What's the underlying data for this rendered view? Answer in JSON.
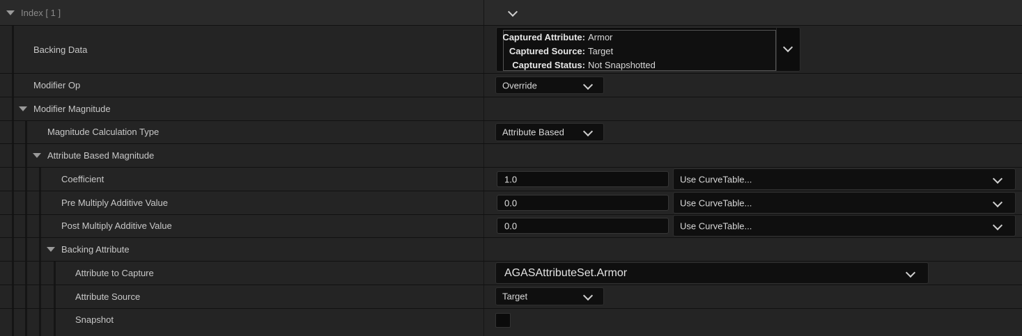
{
  "header": {
    "index_label": "Index [ 1 ]"
  },
  "backing_data": {
    "label": "Backing Data",
    "captured_attribute_key": "Captured Attribute:",
    "captured_attribute_value": "Armor",
    "captured_source_key": "Captured Source:",
    "captured_source_value": "Target",
    "captured_status_key": "Captured Status:",
    "captured_status_value": "Not Snapshotted"
  },
  "modifier_op": {
    "label": "Modifier Op",
    "value": "Override"
  },
  "modifier_magnitude": {
    "label": "Modifier Magnitude"
  },
  "magnitude_calc": {
    "label": "Magnitude Calculation Type",
    "value": "Attribute Based"
  },
  "attribute_based": {
    "label": "Attribute Based Magnitude"
  },
  "coefficient": {
    "label": "Coefficient",
    "value": "1.0",
    "curve": "Use CurveTable..."
  },
  "pre_multiply": {
    "label": "Pre Multiply Additive Value",
    "value": "0.0",
    "curve": "Use CurveTable..."
  },
  "post_multiply": {
    "label": "Post Multiply Additive Value",
    "value": "0.0",
    "curve": "Use CurveTable..."
  },
  "backing_attribute": {
    "label": "Backing Attribute"
  },
  "attribute_to_capture": {
    "label": "Attribute to Capture",
    "value": "AGASAttributeSet.Armor"
  },
  "attribute_source": {
    "label": "Attribute Source",
    "value": "Target"
  },
  "snapshot": {
    "label": "Snapshot",
    "checked": false
  }
}
